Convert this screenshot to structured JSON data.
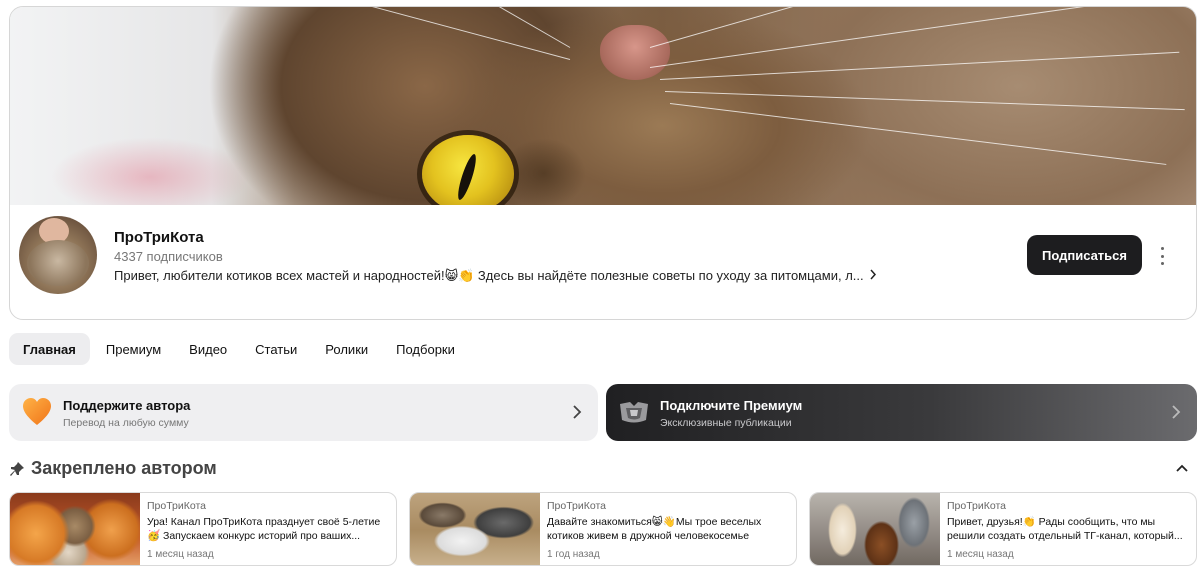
{
  "channel": {
    "name": "ПроТриКота",
    "subscribers": "4337 подписчиков",
    "description": "Привет, любители котиков всех мастей и народностей!😸👏 Здесь вы найдёте полезные советы по уходу за питомцами, л...",
    "subscribe_label": "Подписаться"
  },
  "tabs": [
    {
      "label": "Главная",
      "active": true
    },
    {
      "label": "Премиум"
    },
    {
      "label": "Видео"
    },
    {
      "label": "Статьи"
    },
    {
      "label": "Ролики"
    },
    {
      "label": "Подборки"
    }
  ],
  "promos": {
    "support": {
      "title": "Поддержите автора",
      "subtitle": "Перевод на любую сумму",
      "icon": "heart-icon"
    },
    "premium": {
      "title": "Подключите Премиум",
      "subtitle": "Эксклюзивные публикации",
      "icon": "premium-icon"
    }
  },
  "pinned": {
    "title": "Закреплено автором",
    "posts": [
      {
        "author": "ПроТриКота",
        "text": "Ура! Канал ПроТриКота празднует своё 5-летие 🥳 Запускаем конкурс историй про ваших...",
        "time": "1 месяц назад"
      },
      {
        "author": "ПроТриКота",
        "text": "Давайте знакомиться😸👋Мы трое веселых котиков живем в дружной человекосемье",
        "time": "1 год назад"
      },
      {
        "author": "ПроТриКота",
        "text": "Привет, друзья!👏 Рады сообщить, что мы решили создать отдельный ТГ-канал, который...",
        "time": "1 месяц назад"
      }
    ]
  },
  "colors": {
    "subscribe_bg": "#1d1d1f",
    "support_bg": "#efeff1",
    "premium_bg": "#202022",
    "heart": "#f08a24"
  }
}
